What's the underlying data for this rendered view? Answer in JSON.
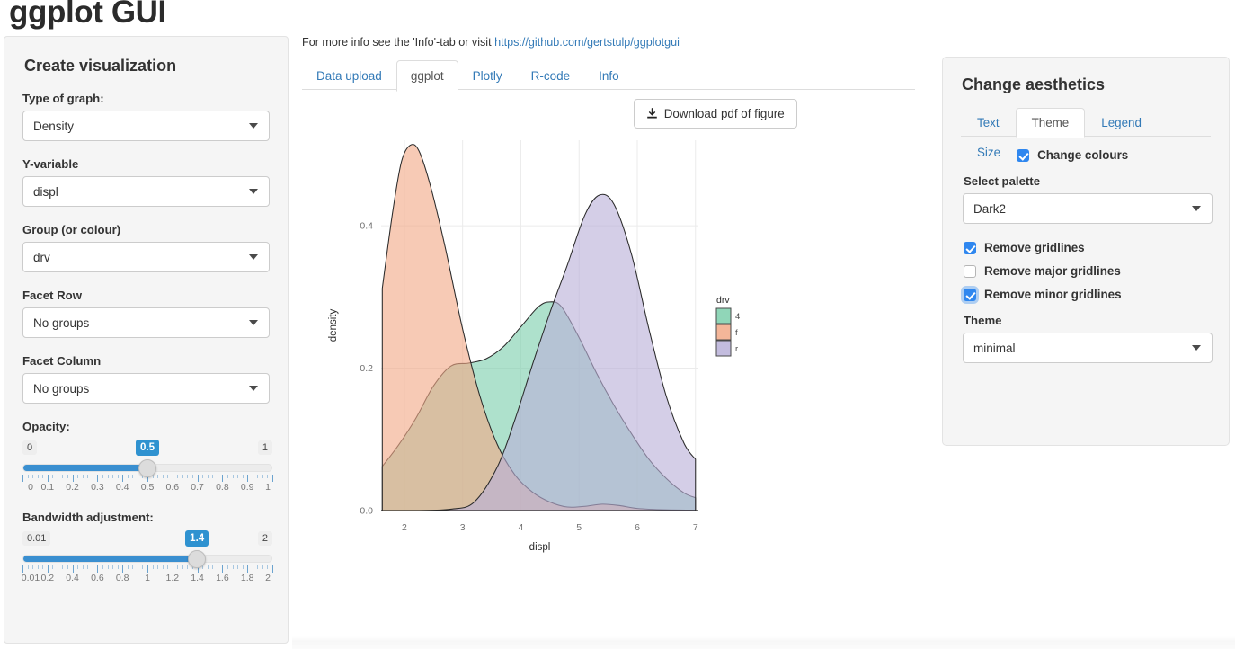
{
  "app": {
    "title": "ggplot GUI"
  },
  "sidebar": {
    "title": "Create visualization",
    "fields": [
      {
        "label": "Type of graph:",
        "value": "Density"
      },
      {
        "label": "Y-variable",
        "value": "displ"
      },
      {
        "label": "Group (or colour)",
        "value": "drv"
      },
      {
        "label": "Facet Row",
        "value": "No groups"
      },
      {
        "label": "Facet Column",
        "value": "No groups"
      }
    ],
    "sliders": [
      {
        "label": "Opacity:",
        "min_label": "0",
        "max_label": "1",
        "value_label": "0.5",
        "value": 0.5,
        "min": 0,
        "max": 1,
        "scale": [
          "0",
          "0.1",
          "0.2",
          "0.3",
          "0.4",
          "0.5",
          "0.6",
          "0.7",
          "0.8",
          "0.9",
          "1"
        ]
      },
      {
        "label": "Bandwidth adjustment:",
        "min_label": "0.01",
        "max_label": "2",
        "value_label": "1.4",
        "value": 1.4,
        "min": 0.01,
        "max": 2,
        "scale": [
          "0.01",
          "0.2",
          "0.4",
          "0.6",
          "0.8",
          "1",
          "1.2",
          "1.4",
          "1.6",
          "1.8",
          "2"
        ]
      }
    ]
  },
  "center": {
    "info_prefix": "For more info see the 'Info'-tab or visit ",
    "info_link": "https://github.com/gertstulp/ggplotgui",
    "tabs": [
      {
        "label": "Data upload",
        "active": false
      },
      {
        "label": "ggplot",
        "active": true
      },
      {
        "label": "Plotly",
        "active": false
      },
      {
        "label": "R-code",
        "active": false
      },
      {
        "label": "Info",
        "active": false
      }
    ],
    "download_button": "Download pdf of figure",
    "download_icon": "download-icon"
  },
  "aesthetics": {
    "title": "Change aesthetics",
    "tabs": [
      {
        "label": "Text",
        "active": false
      },
      {
        "label": "Theme",
        "active": true
      },
      {
        "label": "Legend",
        "active": false
      },
      {
        "label": "Size",
        "active": false
      }
    ],
    "checkboxes": [
      {
        "label": "Change colours",
        "checked": true,
        "focused": false
      },
      {
        "label": "Remove gridlines",
        "checked": true,
        "focused": false
      },
      {
        "label": "Remove major gridlines",
        "checked": false,
        "focused": false
      },
      {
        "label": "Remove minor gridlines",
        "checked": true,
        "focused": true
      }
    ],
    "palette_label": "Select palette",
    "palette_value": "Dark2",
    "theme_label": "Theme",
    "theme_value": "minimal"
  },
  "chart_data": {
    "type": "area",
    "title": "",
    "xlabel": "displ",
    "ylabel": "density",
    "xlim": [
      1.6,
      7.05
    ],
    "ylim": [
      0.0,
      0.52
    ],
    "xticks": [
      2,
      3,
      4,
      5,
      6,
      7
    ],
    "yticks": [
      "0.0",
      "0.2",
      "0.4"
    ],
    "ytick_values": [
      0.0,
      0.2,
      0.4
    ],
    "grid": "major-only",
    "legend": {
      "title": "drv",
      "position": "right",
      "entries": [
        {
          "label": "4",
          "color": "#7DCFAC"
        },
        {
          "label": "f",
          "color": "#F2A987"
        },
        {
          "label": "r",
          "color": "#B9B0D8"
        }
      ]
    },
    "series": [
      {
        "name": "4",
        "color": "#7DCFAC",
        "x": [
          1.62,
          1.9,
          2.2,
          2.5,
          2.8,
          3.1,
          3.4,
          3.7,
          4.0,
          4.3,
          4.5,
          4.7,
          5.0,
          5.3,
          5.6,
          5.9,
          6.2,
          6.5,
          6.8,
          7.0
        ],
        "y": [
          0.062,
          0.092,
          0.13,
          0.175,
          0.203,
          0.207,
          0.213,
          0.23,
          0.258,
          0.286,
          0.293,
          0.286,
          0.243,
          0.193,
          0.148,
          0.108,
          0.072,
          0.045,
          0.025,
          0.018
        ]
      },
      {
        "name": "f",
        "color": "#F2A987",
        "x": [
          1.62,
          1.8,
          1.95,
          2.1,
          2.25,
          2.45,
          2.7,
          3.0,
          3.3,
          3.6,
          3.9,
          4.2,
          4.5,
          4.8,
          5.1,
          5.4,
          5.7,
          6.0,
          6.5,
          7.0
        ],
        "y": [
          0.312,
          0.42,
          0.49,
          0.513,
          0.505,
          0.455,
          0.37,
          0.255,
          0.16,
          0.092,
          0.05,
          0.026,
          0.012,
          0.005,
          0.006,
          0.009,
          0.007,
          0.003,
          0.001,
          0.0005
        ]
      },
      {
        "name": "r",
        "color": "#B9B0D8",
        "x": [
          1.62,
          2.2,
          2.8,
          3.2,
          3.6,
          3.9,
          4.2,
          4.5,
          4.8,
          5.1,
          5.35,
          5.6,
          5.9,
          6.2,
          6.5,
          6.8,
          7.0
        ],
        "y": [
          0.0,
          0.0,
          0.002,
          0.012,
          0.062,
          0.128,
          0.205,
          0.278,
          0.345,
          0.415,
          0.443,
          0.43,
          0.36,
          0.255,
          0.16,
          0.095,
          0.072
        ]
      }
    ]
  }
}
